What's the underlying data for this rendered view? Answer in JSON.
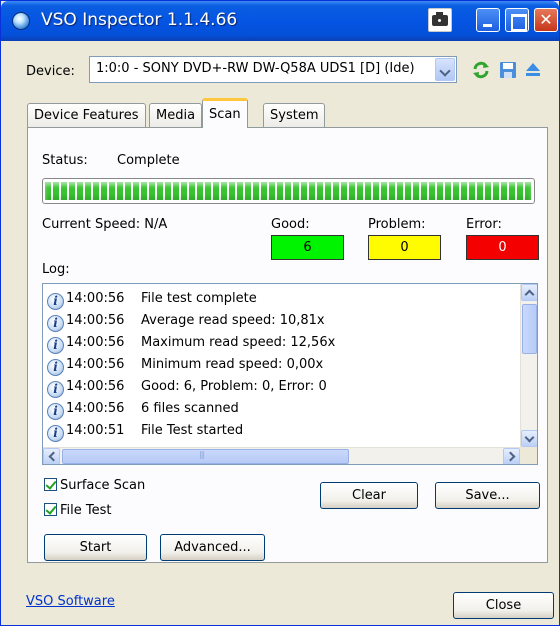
{
  "window": {
    "title": "VSO Inspector 1.1.4.66"
  },
  "device": {
    "label": "Device:",
    "selected": "1:0:0 - SONY DVD+-RW DW-Q58A UDS1 [D] (Ide)"
  },
  "tabs": [
    {
      "label": "Device Features"
    },
    {
      "label": "Media"
    },
    {
      "label": "Scan"
    },
    {
      "label": "System"
    }
  ],
  "scan": {
    "status_label": "Status:",
    "status_value": "Complete",
    "progress": 1.0,
    "current_speed_label": "Current Speed:",
    "current_speed_value": "N/A",
    "good_label": "Good:",
    "problem_label": "Problem:",
    "error_label": "Error:",
    "good_count": "6",
    "problem_count": "0",
    "error_count": "0",
    "log_label": "Log:",
    "log": [
      {
        "time": "14:00:56",
        "message": "File test complete"
      },
      {
        "time": "14:00:56",
        "message": "Average read speed: 10,81x"
      },
      {
        "time": "14:00:56",
        "message": "Maximum read speed: 12,56x"
      },
      {
        "time": "14:00:56",
        "message": "Minimum read speed: 0,00x"
      },
      {
        "time": "14:00:56",
        "message": "Good: 6, Problem: 0, Error: 0"
      },
      {
        "time": "14:00:56",
        "message": "6 files scanned"
      },
      {
        "time": "14:00:51",
        "message": "File Test started"
      }
    ],
    "surface_scan_label": "Surface Scan",
    "surface_scan_checked": true,
    "file_test_label": "File Test",
    "file_test_checked": true,
    "clear_label": "Clear",
    "save_label": "Save...",
    "start_label": "Start",
    "advanced_label": "Advanced..."
  },
  "footer": {
    "link_label": "VSO Software",
    "close_label": "Close"
  },
  "colors": {
    "good": "#00f400",
    "problem": "#fffc00",
    "error": "#f40000",
    "titlebar": "#0554e3",
    "progress": "#37c431"
  }
}
